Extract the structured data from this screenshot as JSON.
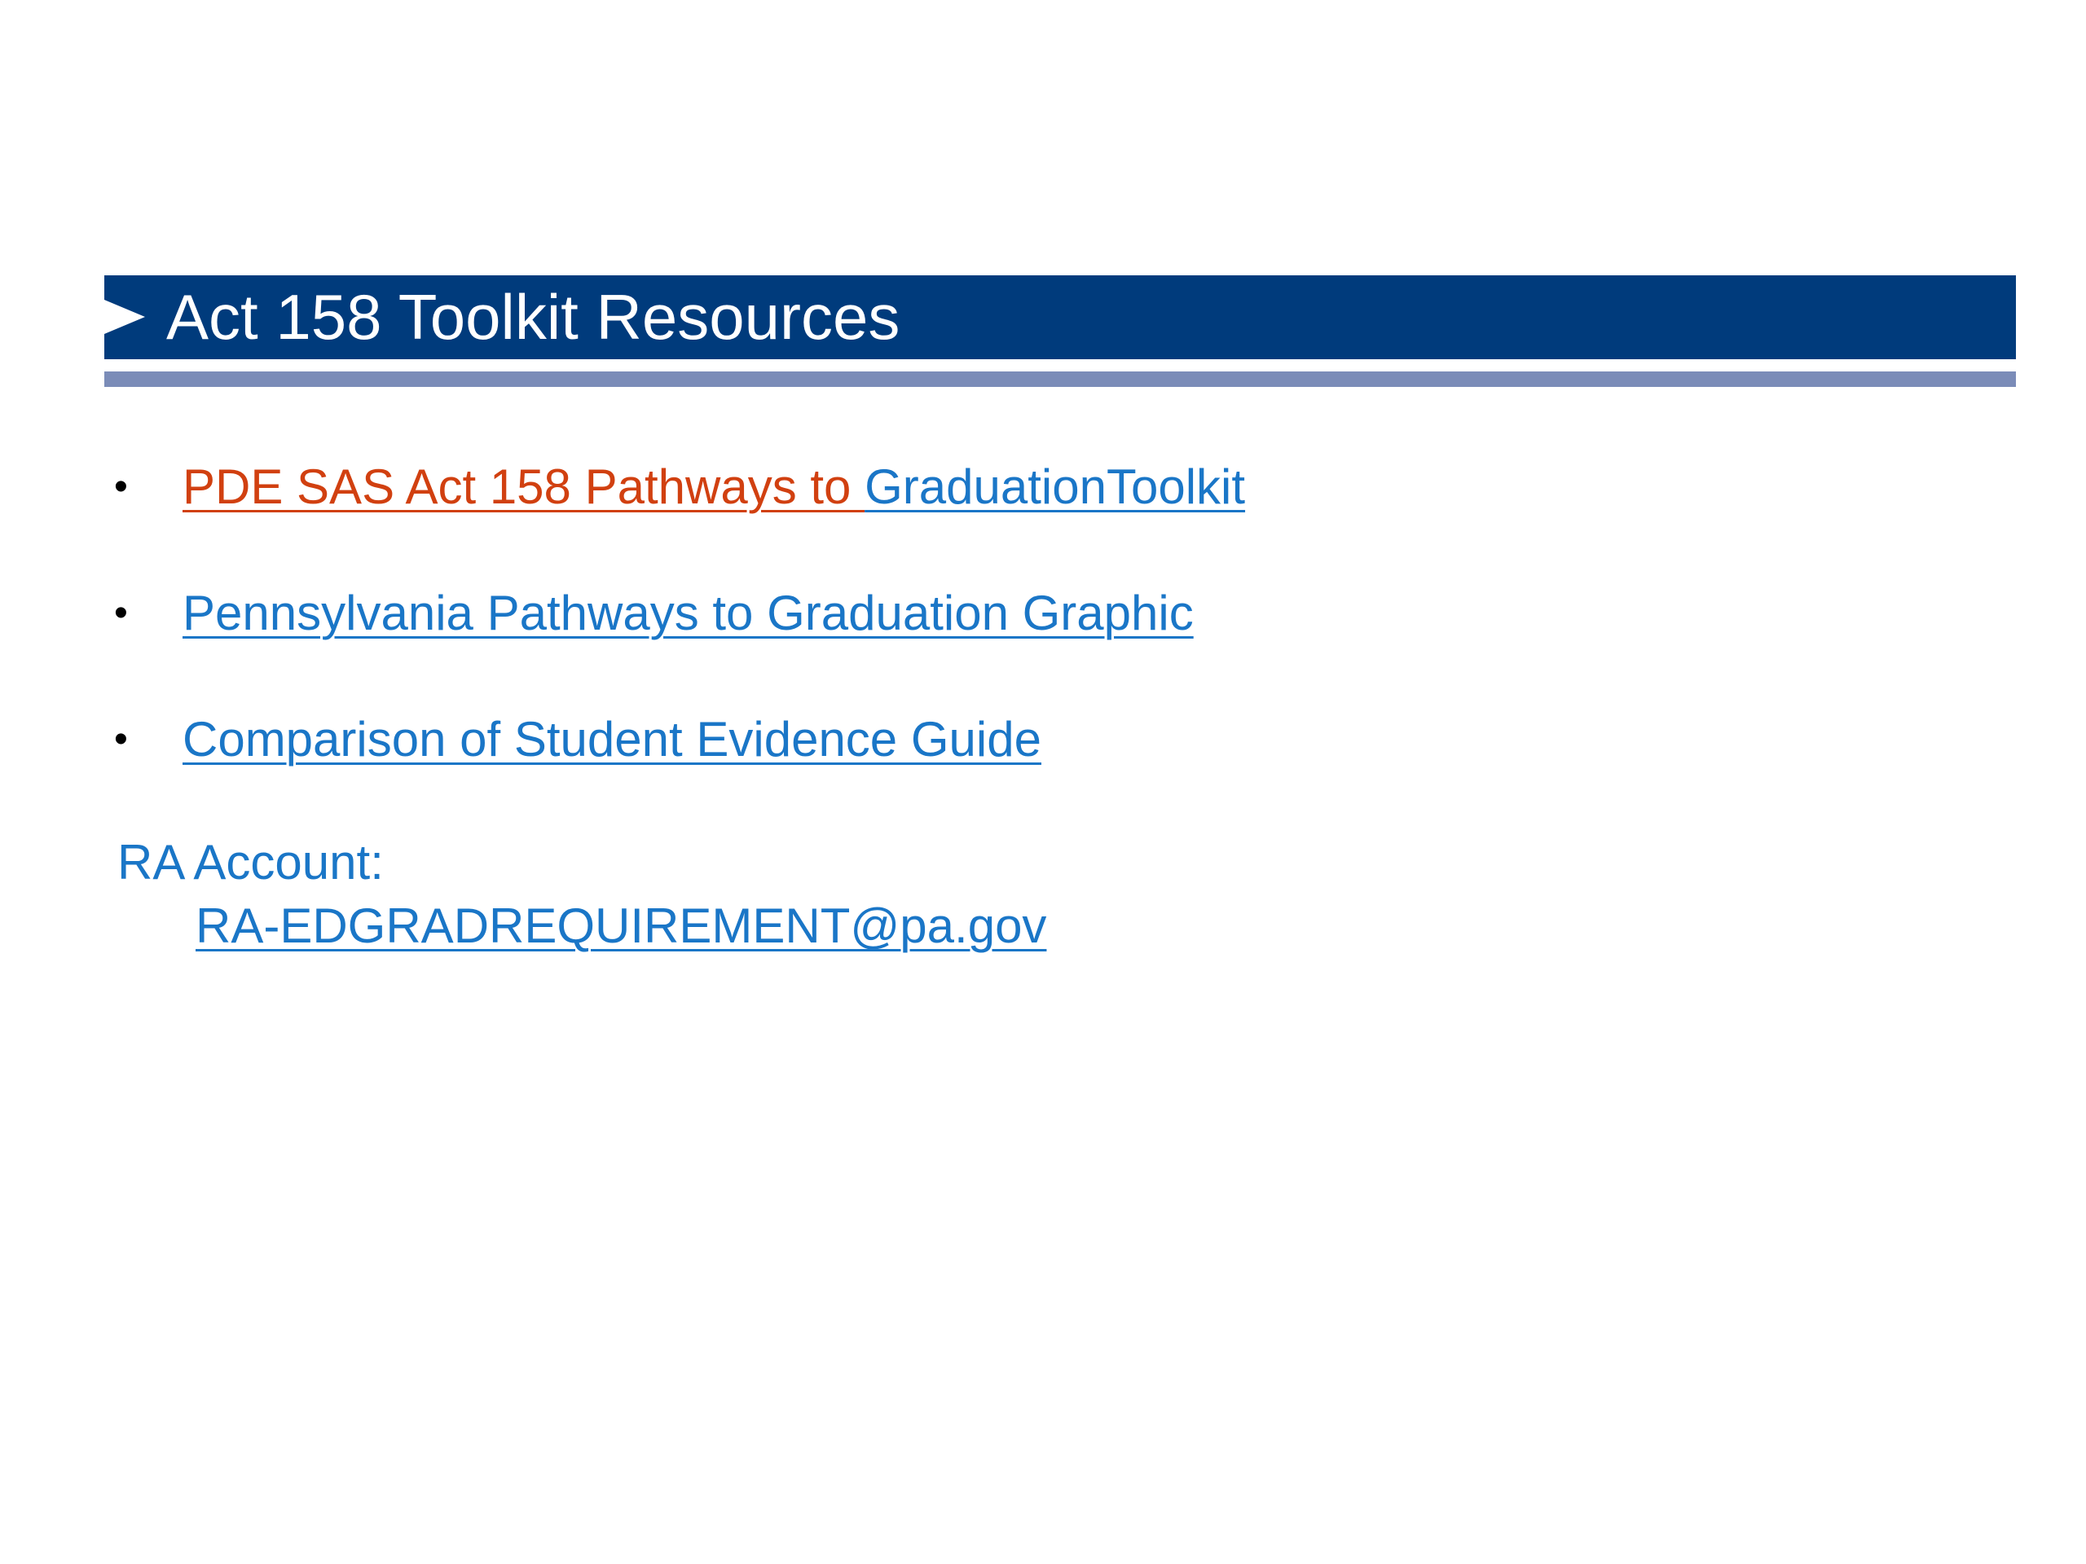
{
  "title": "Act 158 Toolkit Resources",
  "colors": {
    "title_bar": "#003b7c",
    "title_rule": "#7b8cb8",
    "link_blue": "#1a76c7",
    "link_orange": "#d14010"
  },
  "bullets": [
    {
      "marker": "•",
      "part_orange": "PDE SAS Act 158 Pathways to ",
      "part_blue": "GraduationToolkit"
    },
    {
      "marker": "•",
      "text": "Pennsylvania Pathways to Graduation Graphic"
    },
    {
      "marker": "•",
      "text": "Comparison of Student Evidence Guide"
    }
  ],
  "contact": {
    "label": "RA Account:",
    "email": "RA-EDGRADREQUIREMENT@pa.gov"
  }
}
